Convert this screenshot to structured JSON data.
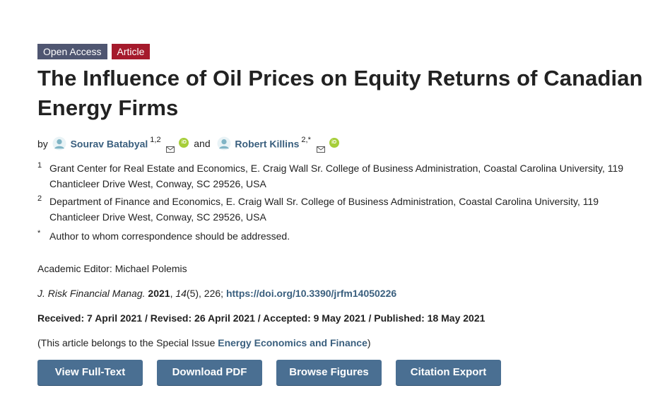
{
  "badges": {
    "open_access": "Open Access",
    "article": "Article"
  },
  "title": "The Influence of Oil Prices on Equity Returns of Canadian Energy Firms",
  "authors": {
    "by": "by",
    "and": "and",
    "list": [
      {
        "name": "Sourav Batabyal",
        "sup": "1,2"
      },
      {
        "name": "Robert Killins",
        "sup": "2,*"
      }
    ]
  },
  "affiliations": [
    {
      "num": "1",
      "text": "Grant Center for Real Estate and Economics, E. Craig Wall Sr. College of Business Administration, Coastal Carolina University, 119 Chanticleer Drive West, Conway, SC 29526, USA"
    },
    {
      "num": "2",
      "text": "Department of Finance and Economics, E. Craig Wall Sr. College of Business Administration, Coastal Carolina University, 119 Chanticleer Drive West, Conway, SC 29526, USA"
    },
    {
      "num": "*",
      "text": "Author to whom correspondence should be addressed."
    }
  ],
  "editor": "Academic Editor: Michael Polemis",
  "citation": {
    "journal": "J. Risk Financial Manag.",
    "year": "2021",
    "volume": "14",
    "issue_rest": "(5), 226;",
    "doi": "https://doi.org/10.3390/jrfm14050226"
  },
  "dates": "Received: 7 April 2021 / Revised: 26 April 2021 / Accepted: 9 May 2021 / Published: 18 May 2021",
  "special_issue": {
    "prefix": "(This article belongs to the Special Issue ",
    "link": "Energy Economics and Finance",
    "suffix": ")"
  },
  "buttons": {
    "full_text": "View Full-Text",
    "pdf": "Download PDF",
    "figures": "Browse Figures",
    "export": "Citation Export"
  },
  "colors": {
    "open_access_badge": "#4f5671",
    "article_badge": "#a51a2c",
    "link": "#3a5f7e",
    "button": "#4a6f92",
    "orcid": "#a6ce39"
  },
  "icons": [
    "author-icon",
    "mail-icon",
    "orcid-icon"
  ]
}
